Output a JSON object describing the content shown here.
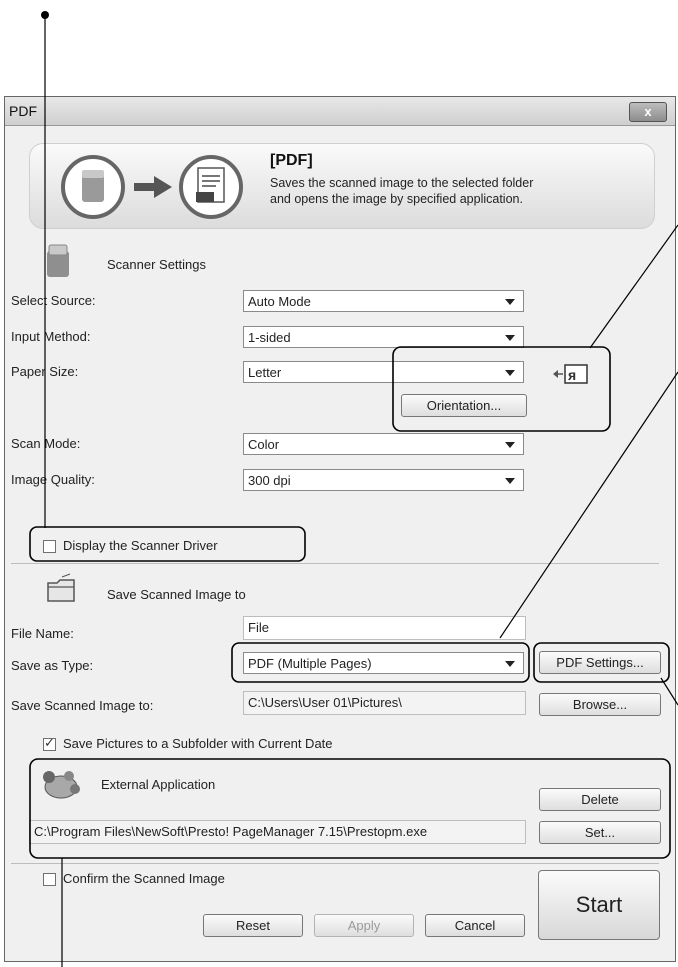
{
  "window": {
    "title": "PDF",
    "close_label": "x"
  },
  "banner": {
    "title": "[PDF]",
    "desc_line1": "Saves the scanned image to the selected folder",
    "desc_line2": "and opens the image by specified application."
  },
  "scanner_settings": {
    "heading": "Scanner Settings",
    "select_source_label": "Select Source:",
    "select_source_value": "Auto Mode",
    "input_method_label": "Input Method:",
    "input_method_value": "1-sided",
    "paper_size_label": "Paper Size:",
    "paper_size_value": "Letter",
    "orientation_button": "Orientation...",
    "scan_mode_label": "Scan Mode:",
    "scan_mode_value": "Color",
    "image_quality_label": "Image Quality:",
    "image_quality_value": "300 dpi",
    "display_driver_label": "Display the Scanner Driver",
    "display_driver_checked": false
  },
  "save_settings": {
    "heading": "Save Scanned Image to",
    "file_name_label": "File Name:",
    "file_name_value": "File",
    "save_type_label": "Save as Type:",
    "save_type_value": "PDF (Multiple Pages)",
    "pdf_settings_button": "PDF Settings...",
    "save_to_label": "Save Scanned Image to:",
    "save_to_value": "C:\\Users\\User 01\\Pictures\\",
    "browse_button": "Browse...",
    "subfolder_label": "Save Pictures to a Subfolder with Current Date",
    "subfolder_checked": true
  },
  "external_app": {
    "heading": "External Application",
    "path": "C:\\Program Files\\NewSoft\\Presto! PageManager 7.15\\Prestopm.exe",
    "delete_button": "Delete",
    "set_button": "Set..."
  },
  "footer": {
    "confirm_label": "Confirm the Scanned Image",
    "confirm_checked": false,
    "reset_button": "Reset",
    "apply_button": "Apply",
    "cancel_button": "Cancel",
    "start_button": "Start"
  }
}
